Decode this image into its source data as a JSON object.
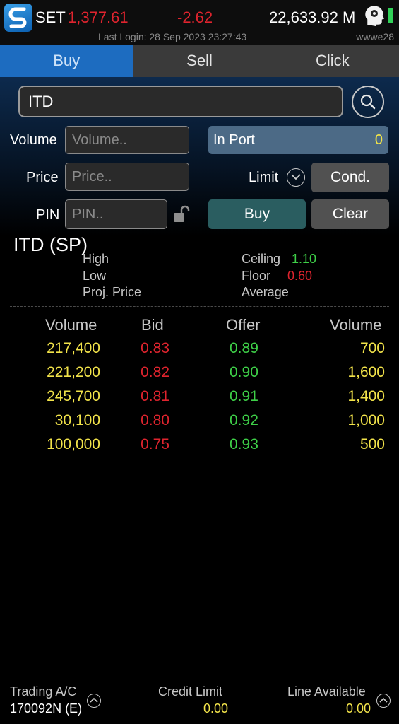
{
  "header": {
    "logo_icon": "streaming-logo-icon",
    "index_name": "SET",
    "index_value": "1,377.61",
    "index_change": "-2.62",
    "volume": "22,633.92 M",
    "profile_icon": "brain-head-icon",
    "last_login": "Last Login: 28 Sep 2023 23:27:43",
    "username": "wwwe28",
    "colors": {
      "down": "#e0242e",
      "battery": "#31d158"
    }
  },
  "tabs": [
    {
      "label": "Buy",
      "active": true
    },
    {
      "label": "Sell",
      "active": false
    },
    {
      "label": "Click",
      "active": false
    }
  ],
  "order_form": {
    "symbol": "ITD",
    "search_icon": "search-icon",
    "volume_label": "Volume",
    "volume_placeholder": "Volume..",
    "price_label": "Price",
    "price_placeholder": "Price..",
    "pin_label": "PIN",
    "pin_placeholder": "PIN..",
    "lock_icon": "unlock-icon",
    "in_port_label": "In Port",
    "in_port_value": "0",
    "order_type": "Limit",
    "cond_label": "Cond.",
    "buy_label": "Buy",
    "clear_label": "Clear"
  },
  "stock_info": {
    "title": "ITD (SP)",
    "high_label": "High",
    "low_label": "Low",
    "proj_price_label": "Proj. Price",
    "ceiling_label": "Ceiling",
    "ceiling_value": "1.10",
    "floor_label": "Floor",
    "floor_value": "0.60",
    "average_label": "Average"
  },
  "bid_offer": {
    "headers": [
      "Volume",
      "Bid",
      "Offer",
      "Volume"
    ],
    "rows": [
      {
        "bid_volume": "217,400",
        "bid": "0.83",
        "offer": "0.89",
        "offer_volume": "700"
      },
      {
        "bid_volume": "221,200",
        "bid": "0.82",
        "offer": "0.90",
        "offer_volume": "1,600"
      },
      {
        "bid_volume": "245,700",
        "bid": "0.81",
        "offer": "0.91",
        "offer_volume": "1,400"
      },
      {
        "bid_volume": "30,100",
        "bid": "0.80",
        "offer": "0.92",
        "offer_volume": "1,000"
      },
      {
        "bid_volume": "100,000",
        "bid": "0.75",
        "offer": "0.93",
        "offer_volume": "500"
      }
    ]
  },
  "footer": {
    "account_label": "Trading A/C",
    "account_value": "170092N (E)",
    "credit_label": "Credit Limit",
    "credit_value": "0.00",
    "line_label": "Line Available",
    "line_value": "0.00"
  }
}
